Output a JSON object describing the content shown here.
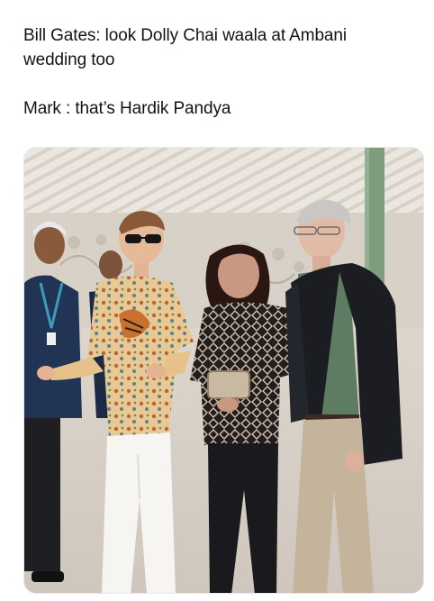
{
  "tweet": {
    "line1": "Bill Gates: look Dolly Chai waala at Ambani",
    "line2": "wedding too",
    "line3": "Mark : that’s Hardik Pandya"
  },
  "media": {
    "subject_icon": "event-photo-icon",
    "colors": {
      "ceiling": "#e9e4dc",
      "floor": "#dad3ca",
      "wall": "#d9d2c8",
      "blazer": "#1b1d22",
      "polo": "#5e7c62",
      "khaki": "#c4b49c",
      "shirt": "#e8c890",
      "trousers": "#f6f5f2",
      "navy": "#223456"
    }
  }
}
